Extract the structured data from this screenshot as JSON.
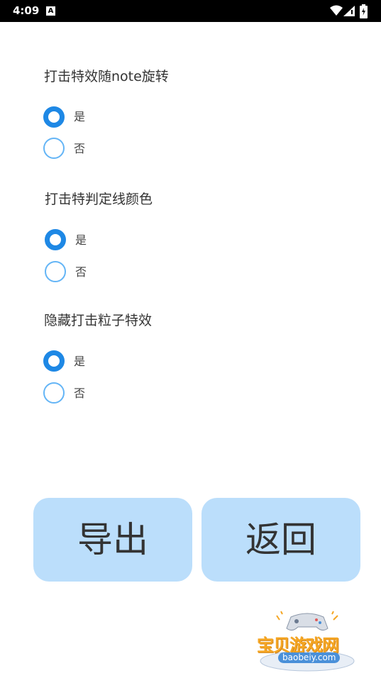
{
  "status_bar": {
    "time": "4:09",
    "notification_icon": "a-letter-icon",
    "icons": [
      "wifi-icon",
      "signal-icon",
      "battery-icon"
    ]
  },
  "settings": [
    {
      "title": "打击特效随note旋转",
      "options": [
        {
          "label": "是",
          "checked": true
        },
        {
          "label": "否",
          "checked": false
        }
      ]
    },
    {
      "title": "打击特判定线颜色",
      "options": [
        {
          "label": "是",
          "checked": true
        },
        {
          "label": "否",
          "checked": false
        }
      ]
    },
    {
      "title": "隐藏打击粒子特效",
      "options": [
        {
          "label": "是",
          "checked": true
        },
        {
          "label": "否",
          "checked": false
        }
      ]
    }
  ],
  "buttons": {
    "export_label": "导出",
    "back_label": "返回"
  },
  "watermark": {
    "text": "宝贝游戏网",
    "url": "baobeiy.com",
    "icon": "gamepad-icon"
  },
  "colors": {
    "accent": "#1e88e5",
    "radio_unchecked": "#64b5f6",
    "button_bg": "#bbdefb",
    "watermark_text": "#f5a623"
  }
}
